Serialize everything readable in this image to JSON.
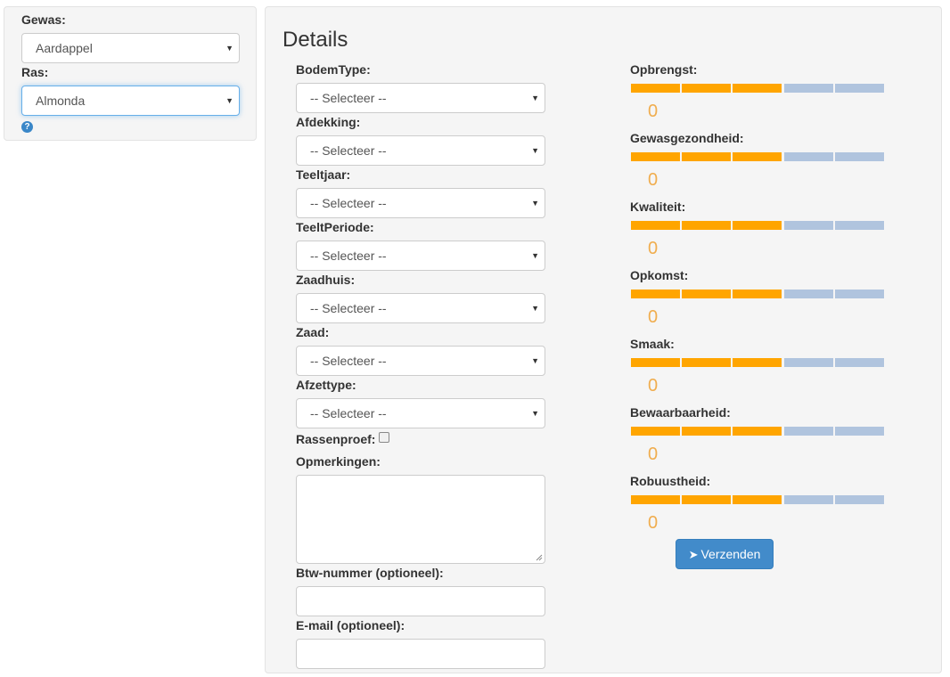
{
  "sidebar": {
    "gewas_label": "Gewas:",
    "gewas_value": "Aardappel",
    "ras_label": "Ras:",
    "ras_value": "Almonda",
    "help_glyph": "?"
  },
  "details": {
    "title": "Details",
    "fields": [
      {
        "label": "BodemType:",
        "value": "-- Selecteer --"
      },
      {
        "label": "Afdekking:",
        "value": "-- Selecteer --"
      },
      {
        "label": "Teeltjaar:",
        "value": "-- Selecteer --"
      },
      {
        "label": "TeeltPeriode:",
        "value": "-- Selecteer --"
      },
      {
        "label": "Zaadhuis:",
        "value": "-- Selecteer --"
      },
      {
        "label": "Zaad:",
        "value": "-- Selecteer --"
      },
      {
        "label": "Afzettype:",
        "value": "-- Selecteer --"
      }
    ],
    "rassenproef_label": "Rassenproef:",
    "rassenproef_checked": false,
    "opmerkingen_label": "Opmerkingen:",
    "opmerkingen_value": "",
    "btw_label": "Btw-nummer (optioneel):",
    "btw_value": "",
    "email_label": "E-mail (optioneel):",
    "email_value": ""
  },
  "ratings": {
    "segments_total": 5,
    "segments_filled": 3,
    "items": [
      {
        "label": "Opbrengst:",
        "score": "0"
      },
      {
        "label": "Gewasgezondheid:",
        "score": "0"
      },
      {
        "label": "Kwaliteit:",
        "score": "0"
      },
      {
        "label": "Opkomst:",
        "score": "0"
      },
      {
        "label": "Smaak:",
        "score": "0"
      },
      {
        "label": "Bewaarbaarheid:",
        "score": "0"
      },
      {
        "label": "Robuustheid:",
        "score": "0"
      }
    ]
  },
  "submit": {
    "label": "Verzenden",
    "icon": "paper-plane-icon",
    "glyph": "➤"
  },
  "colors": {
    "bar_filled": "#ffa500",
    "bar_empty": "#b0c4de",
    "score_text": "#f0ad4e",
    "button": "#428bca"
  },
  "icons": {
    "select_caret": "▼",
    "help": "question-circle-icon"
  }
}
